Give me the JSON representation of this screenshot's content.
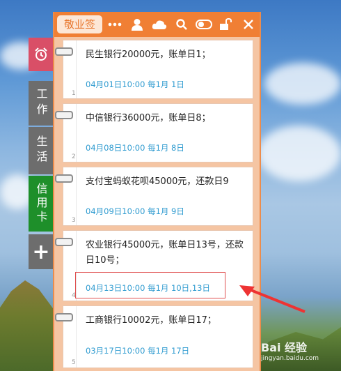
{
  "app": {
    "title": "敬业签"
  },
  "toolbar": [
    "more-icon",
    "user-icon",
    "cloud-icon",
    "search-icon",
    "toggle-icon",
    "lock-icon",
    "close-icon"
  ],
  "side_tabs": [
    {
      "label": "",
      "icon": "alarm-icon"
    },
    {
      "label": "工作"
    },
    {
      "label": "生活"
    },
    {
      "label": "信用卡"
    },
    {
      "label": "+"
    }
  ],
  "notes": [
    {
      "index": "1",
      "text": "民生银行20000元，账单日1；",
      "reminder": "04月01日10:00 每1月 1日"
    },
    {
      "index": "2",
      "text": "中信银行36000元，账单日8；",
      "reminder": "04月08日10:00 每1月 8日"
    },
    {
      "index": "3",
      "text": "支付宝蚂蚁花呗45000元，还款日9",
      "reminder": "04月09日10:00 每1月 9日"
    },
    {
      "index": "4",
      "text": "农业银行45000元，账单日13号，还款日10号；",
      "reminder": "04月13日10:00 每1月 10日,13日"
    },
    {
      "index": "5",
      "text": "工商银行10002元，账单日17；",
      "reminder": "03月17日10:00 每1月 17日"
    }
  ],
  "watermark": {
    "brand": "Bai 经验",
    "url": "jingyan.baidu.com"
  }
}
